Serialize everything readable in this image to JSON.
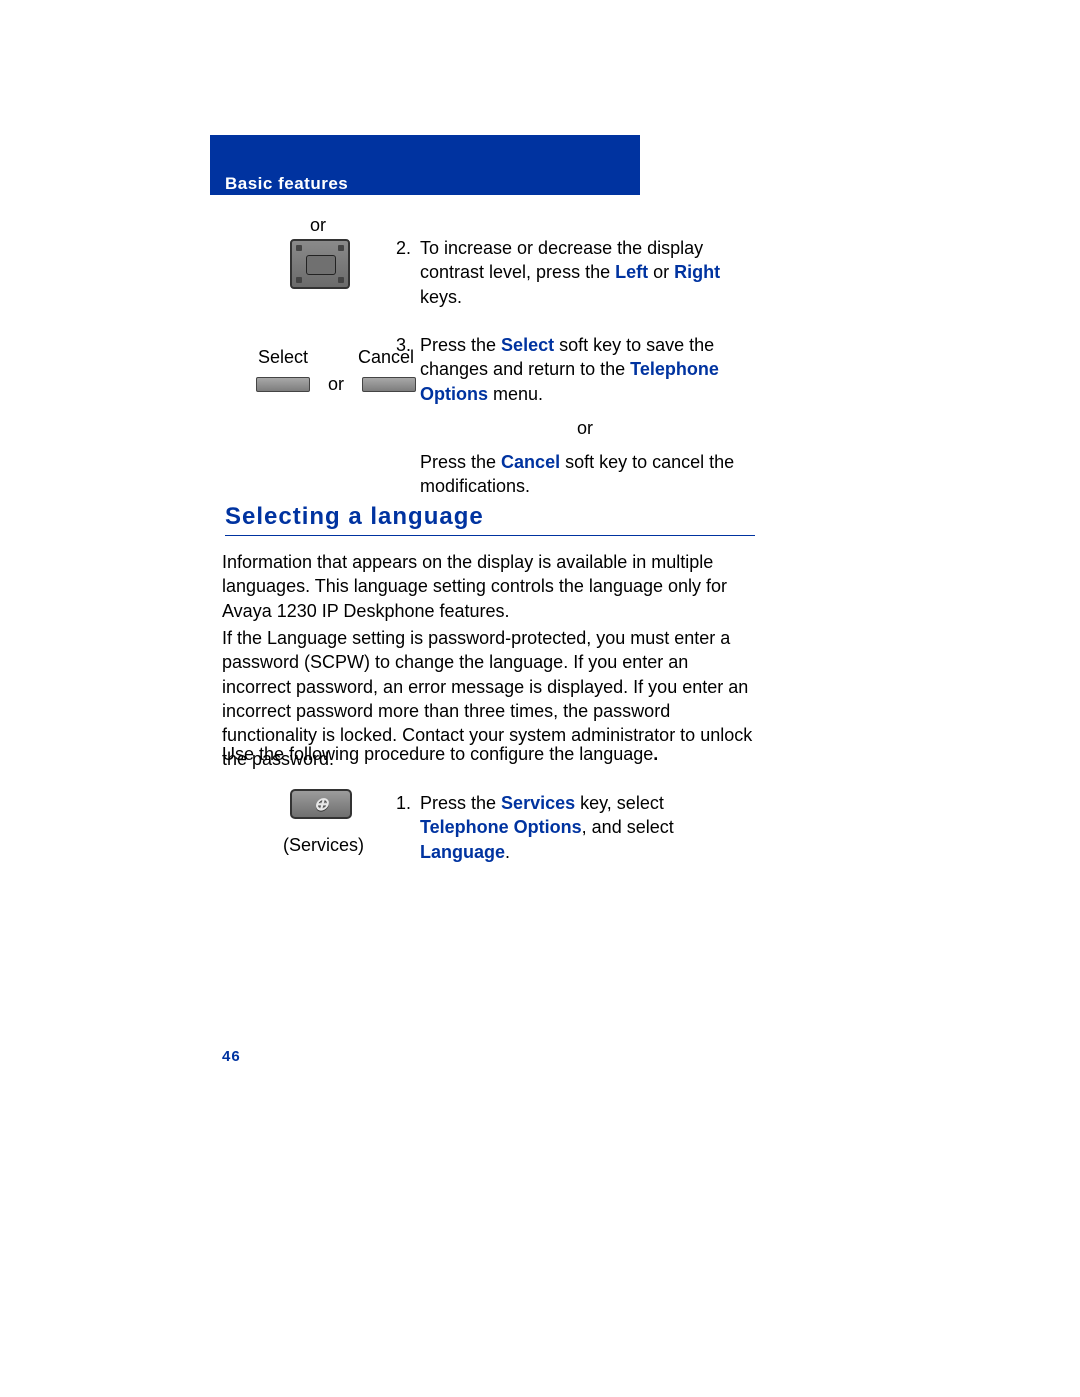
{
  "header": {
    "section": "Basic features"
  },
  "top_or": "or",
  "step2": {
    "num": "2.",
    "pre": "To increase or decrease the display contrast level, press the ",
    "left": "Left",
    "mid": " or ",
    "right": "Right",
    "post": " keys."
  },
  "softkeys": {
    "select": "Select",
    "cancel": "Cancel",
    "or": "or"
  },
  "step3": {
    "num": "3.",
    "a_pre": "Press the ",
    "a_key": "Select",
    "a_mid": " soft key to save the changes and return to the ",
    "a_menu": "Telephone Options",
    "a_post": " menu.",
    "or": "or",
    "b_pre": "Press the ",
    "b_key": "Cancel",
    "b_post": " soft key to cancel the modifications."
  },
  "heading": "Selecting a language",
  "para1": "Information that appears on the display is available in multiple languages. This language setting controls the language only for Avaya 1230 IP Deskphone features.",
  "para2": "If the Language setting is password-protected, you must enter a password (SCPW) to change the language. If you enter an incorrect password, an error message is displayed. If you enter an incorrect password more than three times, the password functionality is locked. Contact your system administrator to unlock the password.",
  "para3_pre": "Use the following procedure to configure the language",
  "para3_post": ".",
  "services_label": "(Services)",
  "step1": {
    "num": "1.",
    "pre": "Press the ",
    "k1": "Services",
    "mid1": " key, select ",
    "k2": "Telephone Options",
    "mid2": ", and select ",
    "k3": "Language",
    "post": "."
  },
  "page_number": "46"
}
